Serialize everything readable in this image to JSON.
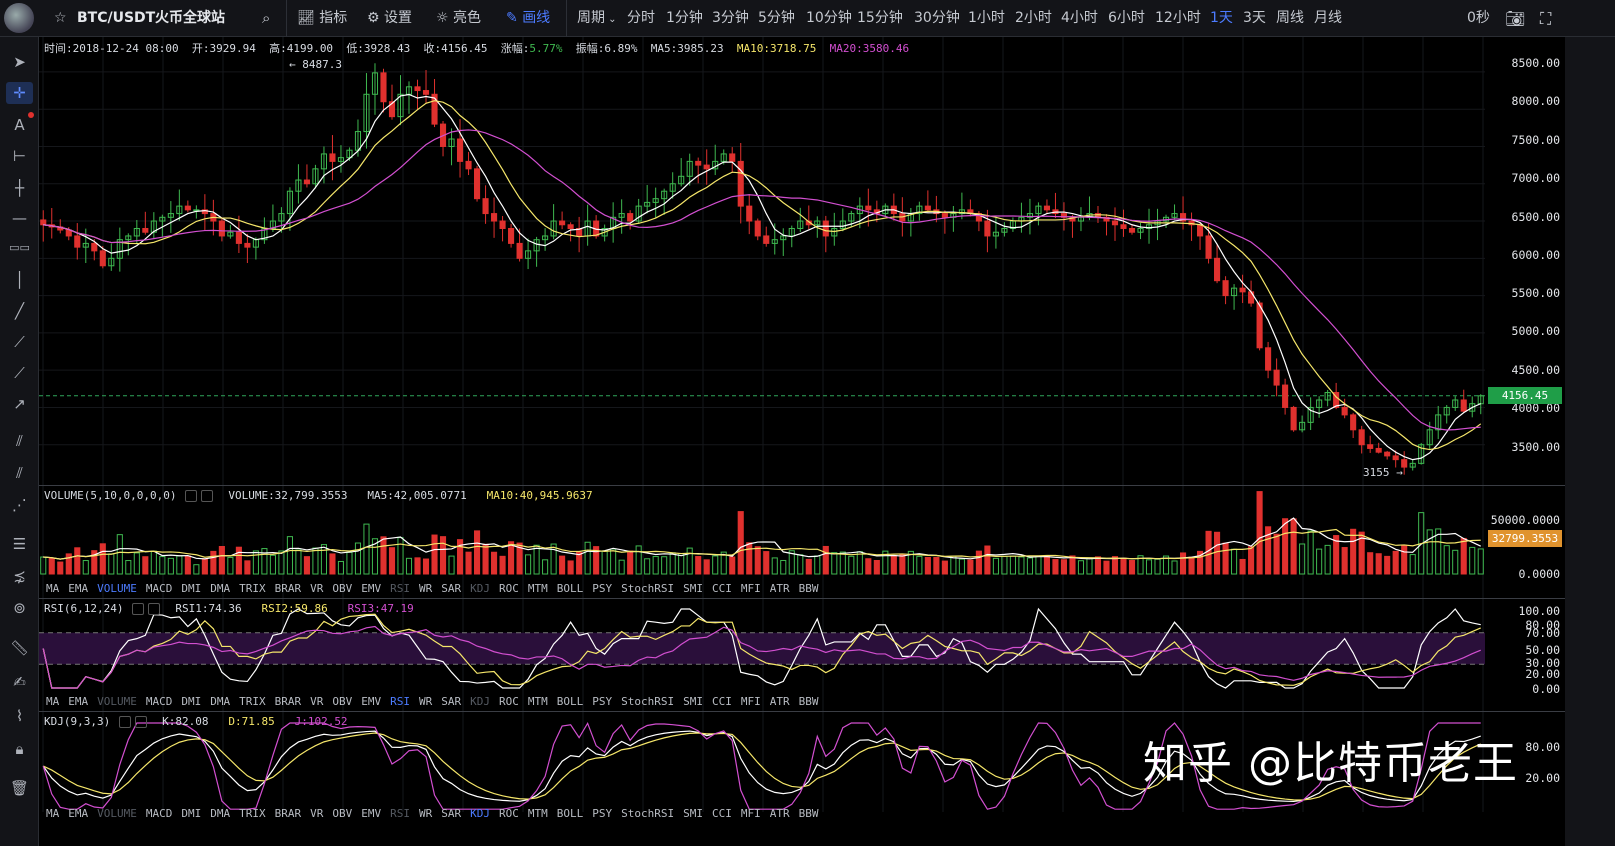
{
  "toolbar": {
    "symbol": "BTC/USDT",
    "exchange": "火币全球站",
    "indicator": "指标",
    "settings": "设置",
    "theme": "亮色",
    "draw": "画线",
    "period": "周期",
    "intervals": [
      "分时",
      "1分钟",
      "3分钟",
      "5分钟",
      "10分钟",
      "15分钟",
      "30分钟",
      "1小时",
      "2小时",
      "4小时",
      "6小时",
      "12小时",
      "1天",
      "3天",
      "周线",
      "月线"
    ],
    "active_interval": "1天",
    "countdown": "0秒"
  },
  "info": {
    "time": "时间:2018-12-24 08:00",
    "open": "开:3929.94",
    "high": "高:4199.00",
    "low": "低:3928.43",
    "close": "收:4156.45",
    "change_label": "涨幅:",
    "change_value": "5.77%",
    "amplitude": "振幅:6.89%",
    "ma5": "MA5:3985.23",
    "ma10": "MA10:3718.75",
    "ma20": "MA20:3580.46"
  },
  "price_axis": [
    "8500.00",
    "8000.00",
    "7500.00",
    "7000.00",
    "6500.00",
    "6000.00",
    "5500.00",
    "5000.00",
    "4500.00",
    "4000.00",
    "3500.00"
  ],
  "last_price": "4156.45",
  "high_marker": "8487.3",
  "low_marker": "3155",
  "volume": {
    "title": "VOLUME(5,10,0,0,0,0)",
    "value": "VOLUME:32,799.3553",
    "ma5": "MA5:42,005.0771",
    "ma10": "MA10:40,945.9637",
    "axis": [
      "50000.0000",
      "0.0000"
    ],
    "last": "32799.3553"
  },
  "indicator_tabs": [
    "MA",
    "EMA",
    "VOLUME",
    "MACD",
    "DMI",
    "DMA",
    "TRIX",
    "BRAR",
    "VR",
    "OBV",
    "EMV",
    "RSI",
    "WR",
    "SAR",
    "KDJ",
    "ROC",
    "MTM",
    "BOLL",
    "PSY",
    "StochRSI",
    "SMI",
    "CCI",
    "MFI",
    "ATR",
    "BBW"
  ],
  "rsi": {
    "title": "RSI(6,12,24)",
    "rsi1": "RSI1:74.36",
    "rsi2": "RSI2:59.86",
    "rsi3": "RSI3:47.19",
    "axis": [
      "100.00",
      "80.00",
      "70.00",
      "50.00",
      "30.00",
      "20.00",
      "0.00"
    ]
  },
  "kdj": {
    "title": "KDJ(9,3,3)",
    "k": "K:82.08",
    "d": "D:71.85",
    "j": "J:102.52",
    "axis": [
      "80.00",
      "20.00"
    ]
  },
  "watermark": "知乎 @比特币老王",
  "colors": {
    "up": "#3fb950",
    "down": "#e0312e",
    "ma5": "#ffffff",
    "ma10": "#f5e66a",
    "ma20": "#d24fd0",
    "accent": "#4c7bff"
  },
  "chart_data": {
    "type": "candlestick",
    "closes": [
      6450,
      6420,
      6380,
      6300,
      6150,
      6200,
      6100,
      5900,
      6000,
      6250,
      6300,
      6400,
      6350,
      6500,
      6550,
      6600,
      6700,
      6650,
      6650,
      6600,
      6500,
      6300,
      6350,
      6200,
      6150,
      6250,
      6400,
      6500,
      6600,
      6900,
      7050,
      7000,
      7200,
      7400,
      7300,
      7350,
      7450,
      7700,
      8200,
      8487,
      8100,
      7900,
      8200,
      8300,
      8250,
      8200,
      7800,
      7500,
      7600,
      7300,
      7200,
      6800,
      6600,
      6500,
      6400,
      6200,
      6000,
      6100,
      6250,
      6300,
      6500,
      6450,
      6400,
      6300,
      6500,
      6300,
      6400,
      6550,
      6600,
      6500,
      6700,
      6750,
      6800,
      6900,
      7000,
      7100,
      7300,
      7250,
      7200,
      7300,
      7400,
      7300,
      6700,
      6500,
      6300,
      6200,
      6250,
      6300,
      6400,
      6500,
      6450,
      6500,
      6300,
      6400,
      6500,
      6600,
      6700,
      6650,
      6600,
      6700,
      6600,
      6500,
      6600,
      6700,
      6650,
      6600,
      6550,
      6600,
      6650,
      6600,
      6500,
      6300,
      6350,
      6400,
      6500,
      6550,
      6600,
      6700,
      6650,
      6600,
      6550,
      6500,
      6550,
      6600,
      6550,
      6500,
      6450,
      6400,
      6350,
      6400,
      6450,
      6500,
      6550,
      6600,
      6500,
      6450,
      6300,
      6000,
      5700,
      5500,
      5600,
      5550,
      5400,
      4800,
      4500,
      4300,
      4000,
      3700,
      3800,
      4000,
      4100,
      4200,
      4000,
      3900,
      3700,
      3500,
      3450,
      3400,
      3350,
      3300,
      3200,
      3250,
      3500,
      3700,
      3900,
      4000,
      4100,
      3950,
      4050,
      4156
    ],
    "high_label": 8487.3,
    "low_label": 3155,
    "ylim": [
      3000,
      8700
    ]
  }
}
